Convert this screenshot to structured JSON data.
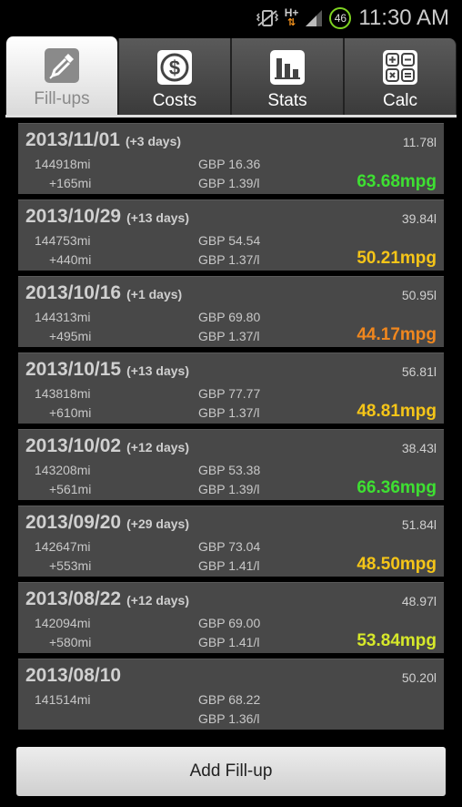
{
  "status_bar": {
    "network_type": "H+",
    "battery_level": "46",
    "time": "11:30 AM",
    "icons": [
      "vibrate-mute-icon",
      "network-hplus-icon",
      "signal-icon",
      "battery-icon"
    ]
  },
  "tabs": [
    {
      "label": "Fill-ups",
      "icon": "fuel-nozzle-icon",
      "active": true
    },
    {
      "label": "Costs",
      "icon": "dollar-icon",
      "active": false
    },
    {
      "label": "Stats",
      "icon": "bar-chart-icon",
      "active": false
    },
    {
      "label": "Calc",
      "icon": "calculator-icon",
      "active": false
    }
  ],
  "colors": {
    "mpg_green": "#3ee032",
    "mpg_yellow": "#f5c518",
    "mpg_orange": "#f0871e",
    "mpg_lime": "#d6e82a"
  },
  "fillups": [
    {
      "date": "2013/11/01",
      "days": "(+3 days)",
      "liters": "11.78l",
      "odometer": "144918mi",
      "distance": "+165mi",
      "cost": "GBP 16.36",
      "price_per_liter": "GBP 1.39/l",
      "mpg": "63.68mpg",
      "mpg_color": "#3ee032"
    },
    {
      "date": "2013/10/29",
      "days": "(+13 days)",
      "liters": "39.84l",
      "odometer": "144753mi",
      "distance": "+440mi",
      "cost": "GBP 54.54",
      "price_per_liter": "GBP 1.37/l",
      "mpg": "50.21mpg",
      "mpg_color": "#f5c518"
    },
    {
      "date": "2013/10/16",
      "days": "(+1 days)",
      "liters": "50.95l",
      "odometer": "144313mi",
      "distance": "+495mi",
      "cost": "GBP 69.80",
      "price_per_liter": "GBP 1.37/l",
      "mpg": "44.17mpg",
      "mpg_color": "#f0871e"
    },
    {
      "date": "2013/10/15",
      "days": "(+13 days)",
      "liters": "56.81l",
      "odometer": "143818mi",
      "distance": "+610mi",
      "cost": "GBP 77.77",
      "price_per_liter": "GBP 1.37/l",
      "mpg": "48.81mpg",
      "mpg_color": "#f5c518"
    },
    {
      "date": "2013/10/02",
      "days": "(+12 days)",
      "liters": "38.43l",
      "odometer": "143208mi",
      "distance": "+561mi",
      "cost": "GBP 53.38",
      "price_per_liter": "GBP 1.39/l",
      "mpg": "66.36mpg",
      "mpg_color": "#3ee032"
    },
    {
      "date": "2013/09/20",
      "days": "(+29 days)",
      "liters": "51.84l",
      "odometer": "142647mi",
      "distance": "+553mi",
      "cost": "GBP 73.04",
      "price_per_liter": "GBP 1.41/l",
      "mpg": "48.50mpg",
      "mpg_color": "#f5c518"
    },
    {
      "date": "2013/08/22",
      "days": "(+12 days)",
      "liters": "48.97l",
      "odometer": "142094mi",
      "distance": "+580mi",
      "cost": "GBP 69.00",
      "price_per_liter": "GBP 1.41/l",
      "mpg": "53.84mpg",
      "mpg_color": "#d6e82a"
    },
    {
      "date": "2013/08/10",
      "days": "",
      "liters": "50.20l",
      "odometer": "141514mi",
      "distance": "",
      "cost": "GBP 68.22",
      "price_per_liter": "GBP 1.36/l",
      "mpg": "",
      "mpg_color": "#f5c518"
    }
  ],
  "add_button_label": "Add Fill-up"
}
